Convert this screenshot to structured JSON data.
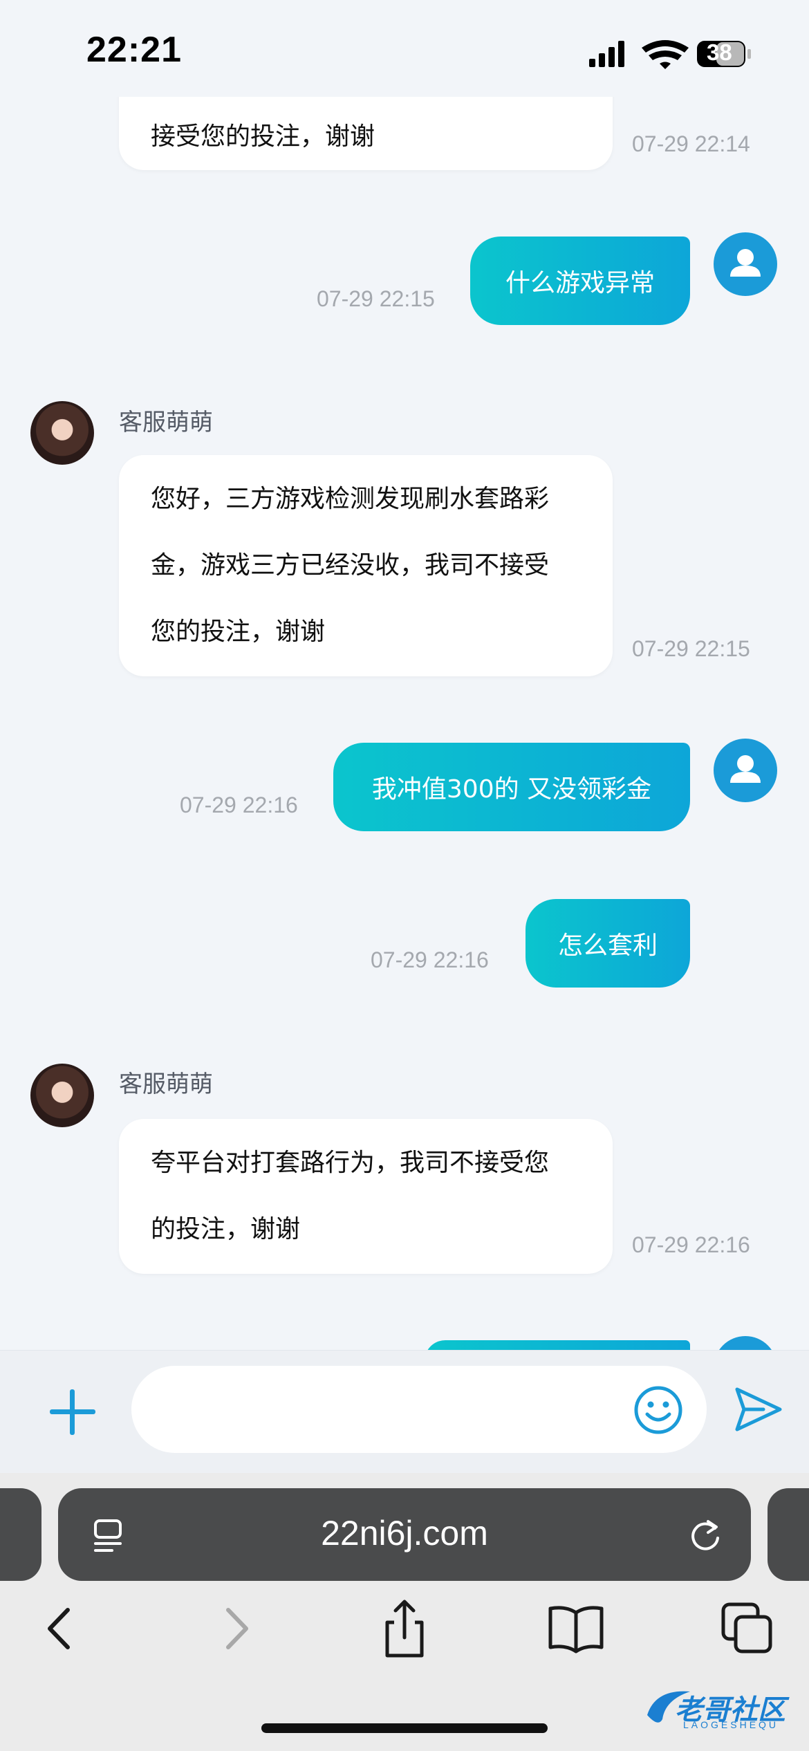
{
  "status_bar": {
    "time": "22:21",
    "battery": "38"
  },
  "messages": [
    {
      "from": "agent",
      "text": "接受您的投注，谢谢",
      "time": "07-29 22:14"
    },
    {
      "from": "user",
      "text": "什么游戏异常",
      "time": "07-29 22:15"
    },
    {
      "from": "agent",
      "sender": "客服萌萌",
      "lines": [
        "您好，三方游戏检测发现刷水套路彩",
        "金，游戏三方已经没收，我司不接受",
        "您的投注，谢谢"
      ],
      "time": "07-29 22:15"
    },
    {
      "from": "user",
      "text": "我冲值300的 又没领彩金",
      "time": "07-29 22:16"
    },
    {
      "from": "user",
      "text": "怎么套利",
      "time": "07-29 22:16"
    },
    {
      "from": "agent",
      "sender": "客服萌萌",
      "lines": [
        "夸平台对打套路行为，我司不接受您",
        "的投注，谢谢"
      ],
      "time": "07-29 22:16"
    }
  ],
  "input_bar": {
    "placeholder": ""
  },
  "browser": {
    "url": "22ni6j.com"
  },
  "watermark": {
    "title": "老哥社区",
    "subtitle": "LAOGESHEQU"
  },
  "colors": {
    "accent": "#1b9bd8",
    "bubble_gradient_start": "#0bc5cd",
    "bubble_gradient_end": "#0da6d8"
  },
  "icons": [
    "signal-icon",
    "wifi-icon",
    "battery-icon",
    "user-avatar-icon",
    "plus-icon",
    "emoji-icon",
    "send-icon",
    "reader-icon",
    "reload-icon",
    "back-icon",
    "forward-icon",
    "share-icon",
    "bookmarks-icon",
    "tabs-icon"
  ]
}
